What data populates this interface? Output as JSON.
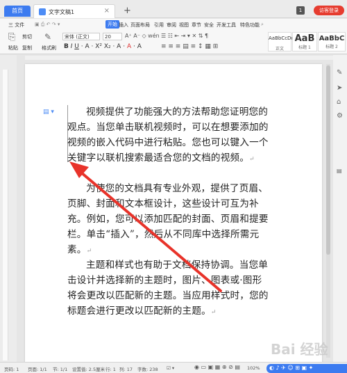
{
  "tabs": {
    "home": "首页",
    "doc": "文字文稿1",
    "login": "访客登录"
  },
  "menu": {
    "file": "三 文件",
    "items": [
      "开始",
      "插入",
      "页面布局",
      "引用",
      "审阅",
      "视图",
      "章节",
      "安全",
      "开发工具",
      "特色功能"
    ]
  },
  "ribbon": {
    "paste": "粘贴",
    "cut": "剪切",
    "copy": "复制",
    "format_painter": "格式刷",
    "font_name": "宋体 (正文)",
    "font_size": "20",
    "styles": [
      {
        "sample": "AaBbCcDd",
        "name": "正文"
      },
      {
        "sample": "AaB",
        "name": "标题 1"
      },
      {
        "sample": "AaBbC",
        "name": "标题 2"
      }
    ]
  },
  "document": {
    "paragraphs": [
      "视频提供了功能强大的方法帮助您证明您的观点。当您单击联机视频时，可以在想要添加的视频的嵌入代码中进行粘贴。您也可以键入一个关键字以联机搜索最适合您的文档的视频。",
      "为使您的文档具有专业外观，提供了页眉、页脚、封面和文本框设计，这些设计可互为补充。例如，您可以添加匹配的封面、页眉和提要栏。单击“插入”，然后从不同库中选择所需元素。",
      "主题和样式也有助于文档保持协调。当您单击设计并选择新的主题时，图片、图表或·图形将会更改以匹配新的主题。当应用样式时，您的标题会进行更改以匹配新的主题。"
    ],
    "para_mark": "↵"
  },
  "status": {
    "page": "页码: 1",
    "pages": "页面: 1/1",
    "section": "节: 1/1",
    "setting": "设置值: 2.5厘米",
    "row": "行: 1",
    "col": "列: 17",
    "words": "字数: 238",
    "zoom": "102%"
  },
  "watermark": "Bai 经验"
}
